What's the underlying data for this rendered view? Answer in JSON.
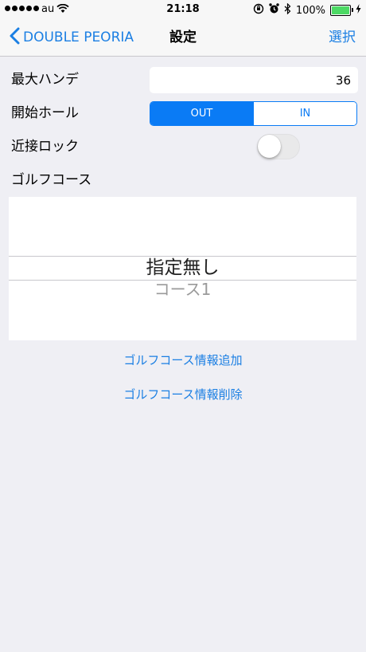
{
  "status_bar": {
    "carrier": "au",
    "time": "21:18",
    "battery_text": "100%",
    "battery_level": 1.0,
    "icons": [
      "signal-dots-icon",
      "wifi-icon",
      "rotation-lock-icon",
      "alarm-icon",
      "bluetooth-icon",
      "battery-icon",
      "charging-bolt-icon"
    ]
  },
  "nav": {
    "back_label": "DOUBLE PEORIA",
    "title": "設定",
    "right_label": "選択"
  },
  "form": {
    "max_handicap_label": "最大ハンデ",
    "max_handicap_value": "36",
    "start_hole_label": "開始ホール",
    "start_hole_options": [
      "OUT",
      "IN"
    ],
    "start_hole_selected": "OUT",
    "proximity_lock_label": "近接ロック",
    "proximity_lock_on": false,
    "golf_course_label": "ゴルフコース"
  },
  "picker": {
    "options": [
      "指定無し",
      "コース1"
    ],
    "selected_index": 0
  },
  "links": {
    "add_course": "ゴルフコース情報追加",
    "delete_course": "ゴルフコース情報削除"
  },
  "colors": {
    "accent": "#1b7fe3",
    "segment_active": "#0a7bf5",
    "background": "#efeff4",
    "battery": "#4cd964"
  }
}
